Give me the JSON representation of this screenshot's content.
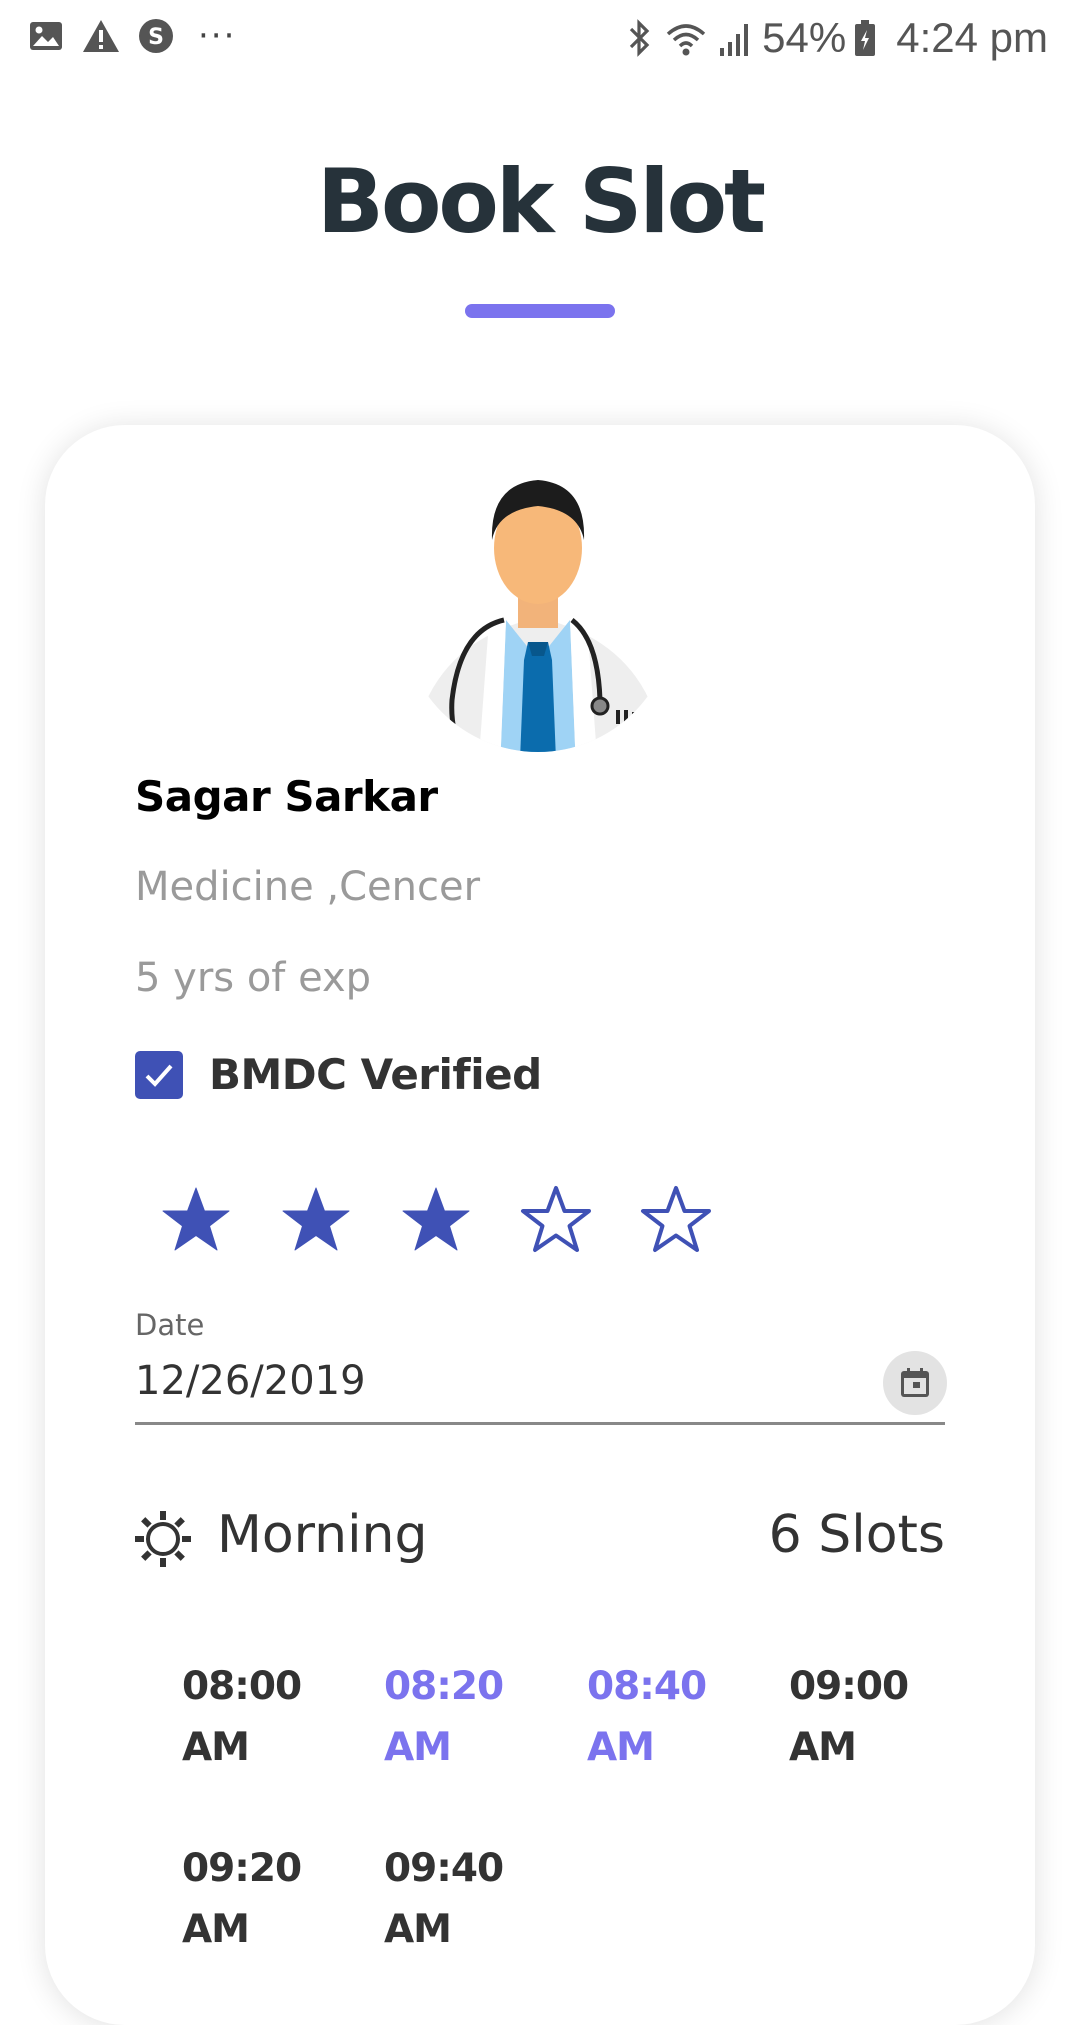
{
  "status_bar": {
    "icons_left": [
      "image-icon",
      "warning-icon",
      "s-app-icon",
      "more-dots-icon"
    ],
    "dots": "···",
    "icons_right": [
      "bluetooth-icon",
      "wifi-icon",
      "signal-icon",
      "battery-icon"
    ],
    "battery": "54%",
    "time": "4:24 pm"
  },
  "header": {
    "title": "Book Slot",
    "accent_color": "#7b73ee"
  },
  "doctor": {
    "avatar_icon": "doctor-avatar",
    "name": "Sagar Sarkar",
    "specialty": "Medicine ,Cencer",
    "experience": "5 yrs of exp",
    "verified_label": "BMDC Verified",
    "verified": true,
    "rating": 3,
    "rating_max": 5
  },
  "date_field": {
    "label": "Date",
    "value": "12/26/2019",
    "icon": "calendar-icon"
  },
  "period": {
    "icon": "sun-icon",
    "label": "Morning",
    "count": "6 Slots"
  },
  "slots": [
    {
      "time": "08:00",
      "ampm": "AM",
      "selected": false
    },
    {
      "time": "08:20",
      "ampm": "AM",
      "selected": true
    },
    {
      "time": "08:40",
      "ampm": "AM",
      "selected": true
    },
    {
      "time": "09:00",
      "ampm": "AM",
      "selected": false
    },
    {
      "time": "09:20",
      "ampm": "AM",
      "selected": false
    },
    {
      "time": "09:40",
      "ampm": "AM",
      "selected": false
    }
  ],
  "colors": {
    "primary": "#3f51b5",
    "accent": "#7b73ee",
    "title": "#26323a",
    "muted": "#9a9a9a"
  }
}
